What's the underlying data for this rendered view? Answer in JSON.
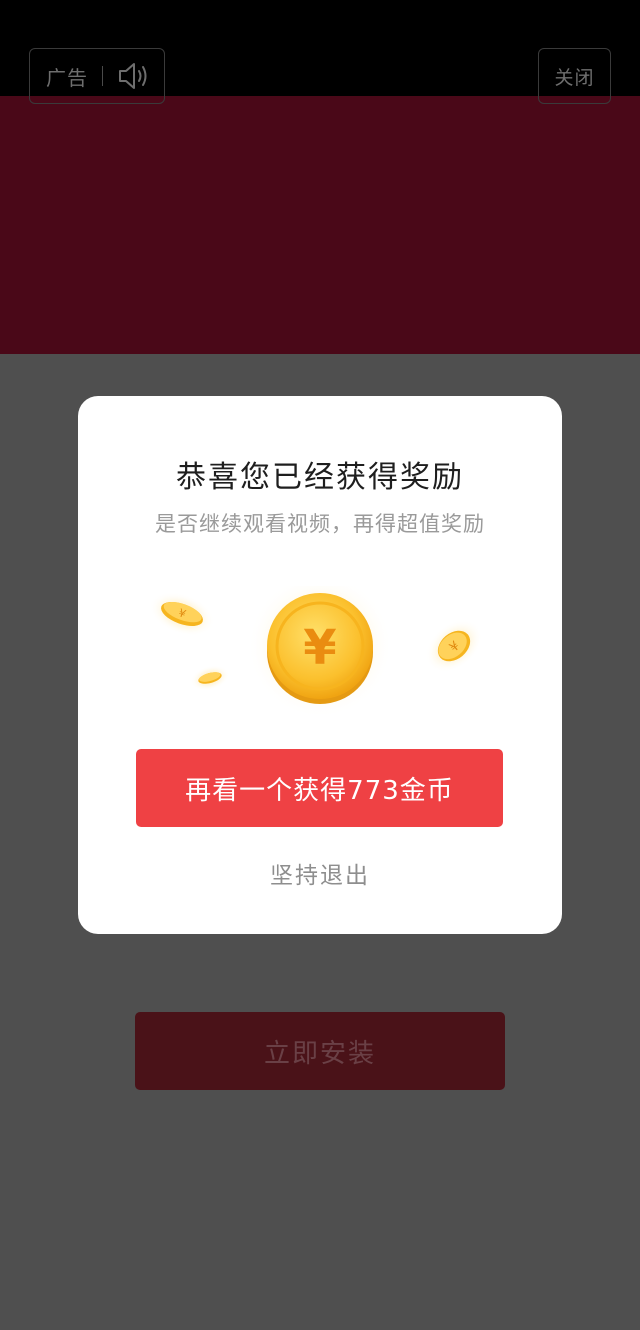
{
  "ad": {
    "badge_label": "广告",
    "close_label": "关闭",
    "install_label": "立即安装",
    "colors": {
      "top_band": "#000000",
      "video_band": "#4a0818",
      "overlay": "#4f4f4f"
    }
  },
  "modal": {
    "title": "恭喜您已经获得奖励",
    "subtitle": "是否继续观看视频，再得超值奖励",
    "coin_symbol": "¥",
    "reward_button_label": "再看一个获得773金币",
    "exit_label": "坚持退出",
    "colors": {
      "reward_button": "#ef4144",
      "coin": "#f6b51f"
    }
  },
  "icons": {
    "speaker": "speaker-icon",
    "coin": "coin-icon"
  }
}
